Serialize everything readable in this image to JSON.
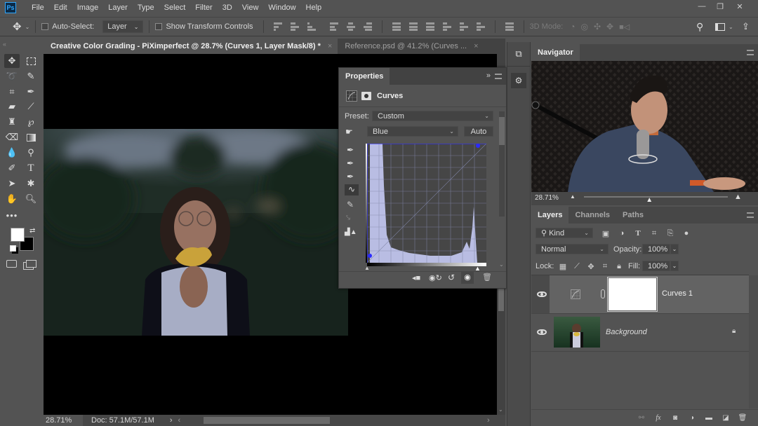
{
  "app": {
    "logo": "Ps",
    "name": "Photoshop"
  },
  "menu": [
    "File",
    "Edit",
    "Image",
    "Layer",
    "Type",
    "Select",
    "Filter",
    "3D",
    "View",
    "Window",
    "Help"
  ],
  "window_controls": {
    "minimize": "—",
    "restore": "❐",
    "close": "✕"
  },
  "options_bar": {
    "auto_select_label": "Auto-Select:",
    "auto_select_checked": false,
    "auto_select_target": "Layer",
    "show_transform_label": "Show Transform Controls",
    "show_transform_checked": false,
    "mode_3d_label": "3D Mode:"
  },
  "document_tabs": [
    {
      "label": "Creative Color Grading - PiXimperfect @ 28.7% (Curves 1, Layer Mask/8) *",
      "active": true
    },
    {
      "label": "Reference.psd @ 41.2% (Curves ...",
      "active": false
    }
  ],
  "status_bar": {
    "zoom": "28.71%",
    "doc_size": "Doc: 57.1M/57.1M",
    "arrow": "›"
  },
  "properties_panel": {
    "tab": "Properties",
    "collapse": "»",
    "adjustment_title": "Curves",
    "preset_label": "Preset:",
    "preset_value": "Custom",
    "channel_value": "Blue",
    "auto_button": "Auto",
    "accent_color": "#2b2bff",
    "histogram_fill": "#b9bde3"
  },
  "navigator": {
    "tab": "Navigator",
    "zoom": "28.71%",
    "zoom_slider_position": 0.45
  },
  "layers_panel": {
    "tabs": [
      "Layers",
      "Channels",
      "Paths"
    ],
    "active_tab": "Layers",
    "filter_kind": "Kind",
    "blend_mode": "Normal",
    "opacity_label": "Opacity:",
    "opacity_value": "100%",
    "lock_label": "Lock:",
    "fill_label": "Fill:",
    "fill_value": "100%",
    "layers": [
      {
        "name": "Curves 1",
        "type": "adjustment",
        "visible": true,
        "selected": true
      },
      {
        "name": "Background",
        "type": "image",
        "visible": true,
        "locked": true
      }
    ]
  },
  "colors": {
    "foreground": "#ffffff",
    "background": "#000000"
  }
}
